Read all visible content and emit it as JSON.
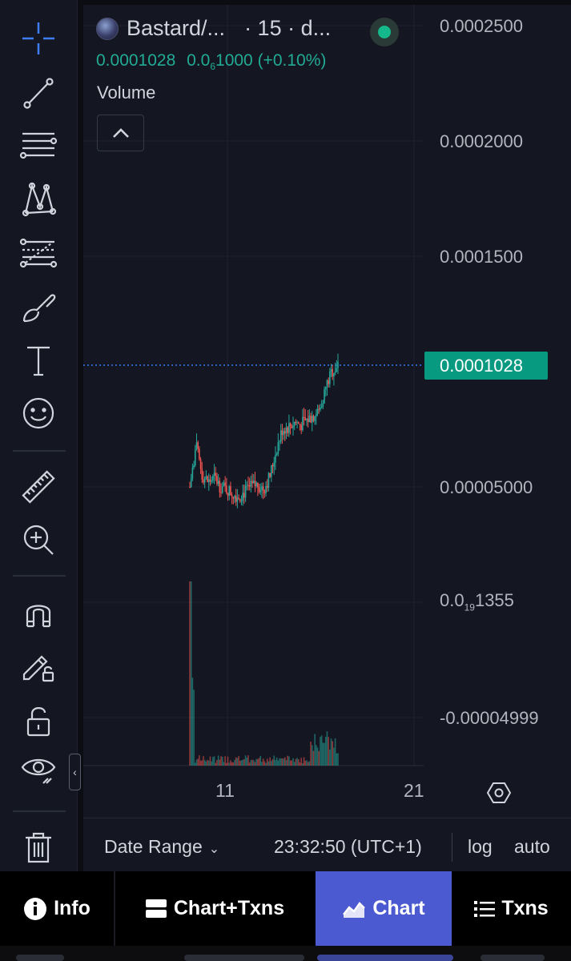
{
  "legend": {
    "pair_label": "Bastard/...",
    "interval_label": "· 15 · d...",
    "last_price": "0.0001028",
    "change_prefix": "0.0",
    "change_sub": "6",
    "change_rest": "1000 (+0.10%)",
    "volume_label": "Volume"
  },
  "price_axis": {
    "labels": [
      "0.0002500",
      "0.0002000",
      "0.0001500",
      "0.00005000"
    ],
    "small_prefix": "0.0",
    "small_sub": "19",
    "small_rest": "1355",
    "negative_label": "-0.00004999",
    "current_price": "0.0001028"
  },
  "time_axis": {
    "labels": [
      "11",
      "21"
    ]
  },
  "bottom_bar": {
    "date_range": "Date Range",
    "clock": "23:32:50 (UTC+1)",
    "log": "log",
    "auto": "auto"
  },
  "tabs": [
    {
      "label": "Info",
      "icon": "info-icon"
    },
    {
      "label": "Chart+Txns",
      "icon": "chart-txns-icon"
    },
    {
      "label": "Chart",
      "icon": "area-chart-icon",
      "active": true
    },
    {
      "label": "Txns",
      "icon": "list-icon"
    }
  ],
  "colors": {
    "up": "#26a69a",
    "down": "#ef5350",
    "current_price_tag": "#089981",
    "active_tab": "#4b5ad0",
    "live_dot": "#14b88a"
  },
  "chart_data": {
    "type": "candlestick",
    "y_axis_ticks": [
      0.00025,
      0.0002,
      0.00015,
      5e-05
    ],
    "current_price": 0.0001028,
    "x_tick_labels": [
      "11",
      "21"
    ],
    "price_path": [
      5e-05,
      6.8e-05,
      5.5e-05,
      5.2e-05,
      5.4e-05,
      5e-05,
      4.9e-05,
      4.7e-05,
      4.6e-05,
      4.8e-05,
      5e-05,
      5.1e-05,
      4.9e-05,
      5.5e-05,
      6.6e-05,
      7.5e-05,
      7.6e-05,
      7.8e-05,
      7.7e-05,
      7.9e-05,
      8.1e-05,
      8.3e-05,
      9.3e-05,
      0.0001,
      0.0001028
    ]
  }
}
